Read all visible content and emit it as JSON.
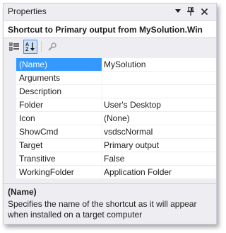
{
  "window": {
    "title": "Properties",
    "buttons": {
      "dropdown": "chevron-down-icon",
      "pin": "pin-icon",
      "close": "close-icon"
    }
  },
  "object_selector": {
    "text": "Shortcut to Primary output from MySolution.Win"
  },
  "toolbar": {
    "categorized": "categorized-icon",
    "alphabetical": "alphabetical-icon",
    "property_pages": "property-pages-icon",
    "alphabetical_active": true
  },
  "properties": [
    {
      "name": "(Name)",
      "value": "MySolution"
    },
    {
      "name": "Arguments",
      "value": ""
    },
    {
      "name": "Description",
      "value": ""
    },
    {
      "name": "Folder",
      "value": "User's Desktop"
    },
    {
      "name": "Icon",
      "value": "(None)"
    },
    {
      "name": "ShowCmd",
      "value": "vsdscNormal"
    },
    {
      "name": "Target",
      "value": "Primary output"
    },
    {
      "name": "Transitive",
      "value": "False"
    },
    {
      "name": "WorkingFolder",
      "value": "Application Folder"
    }
  ],
  "selected_property": "(Name)",
  "description": {
    "title": "(Name)",
    "text": "Specifies the name of the shortcut as it will appear when installed on a target computer"
  },
  "colors": {
    "panel_bg": "#eeeef2",
    "selection": "#3399ff",
    "border": "#cccedb"
  }
}
